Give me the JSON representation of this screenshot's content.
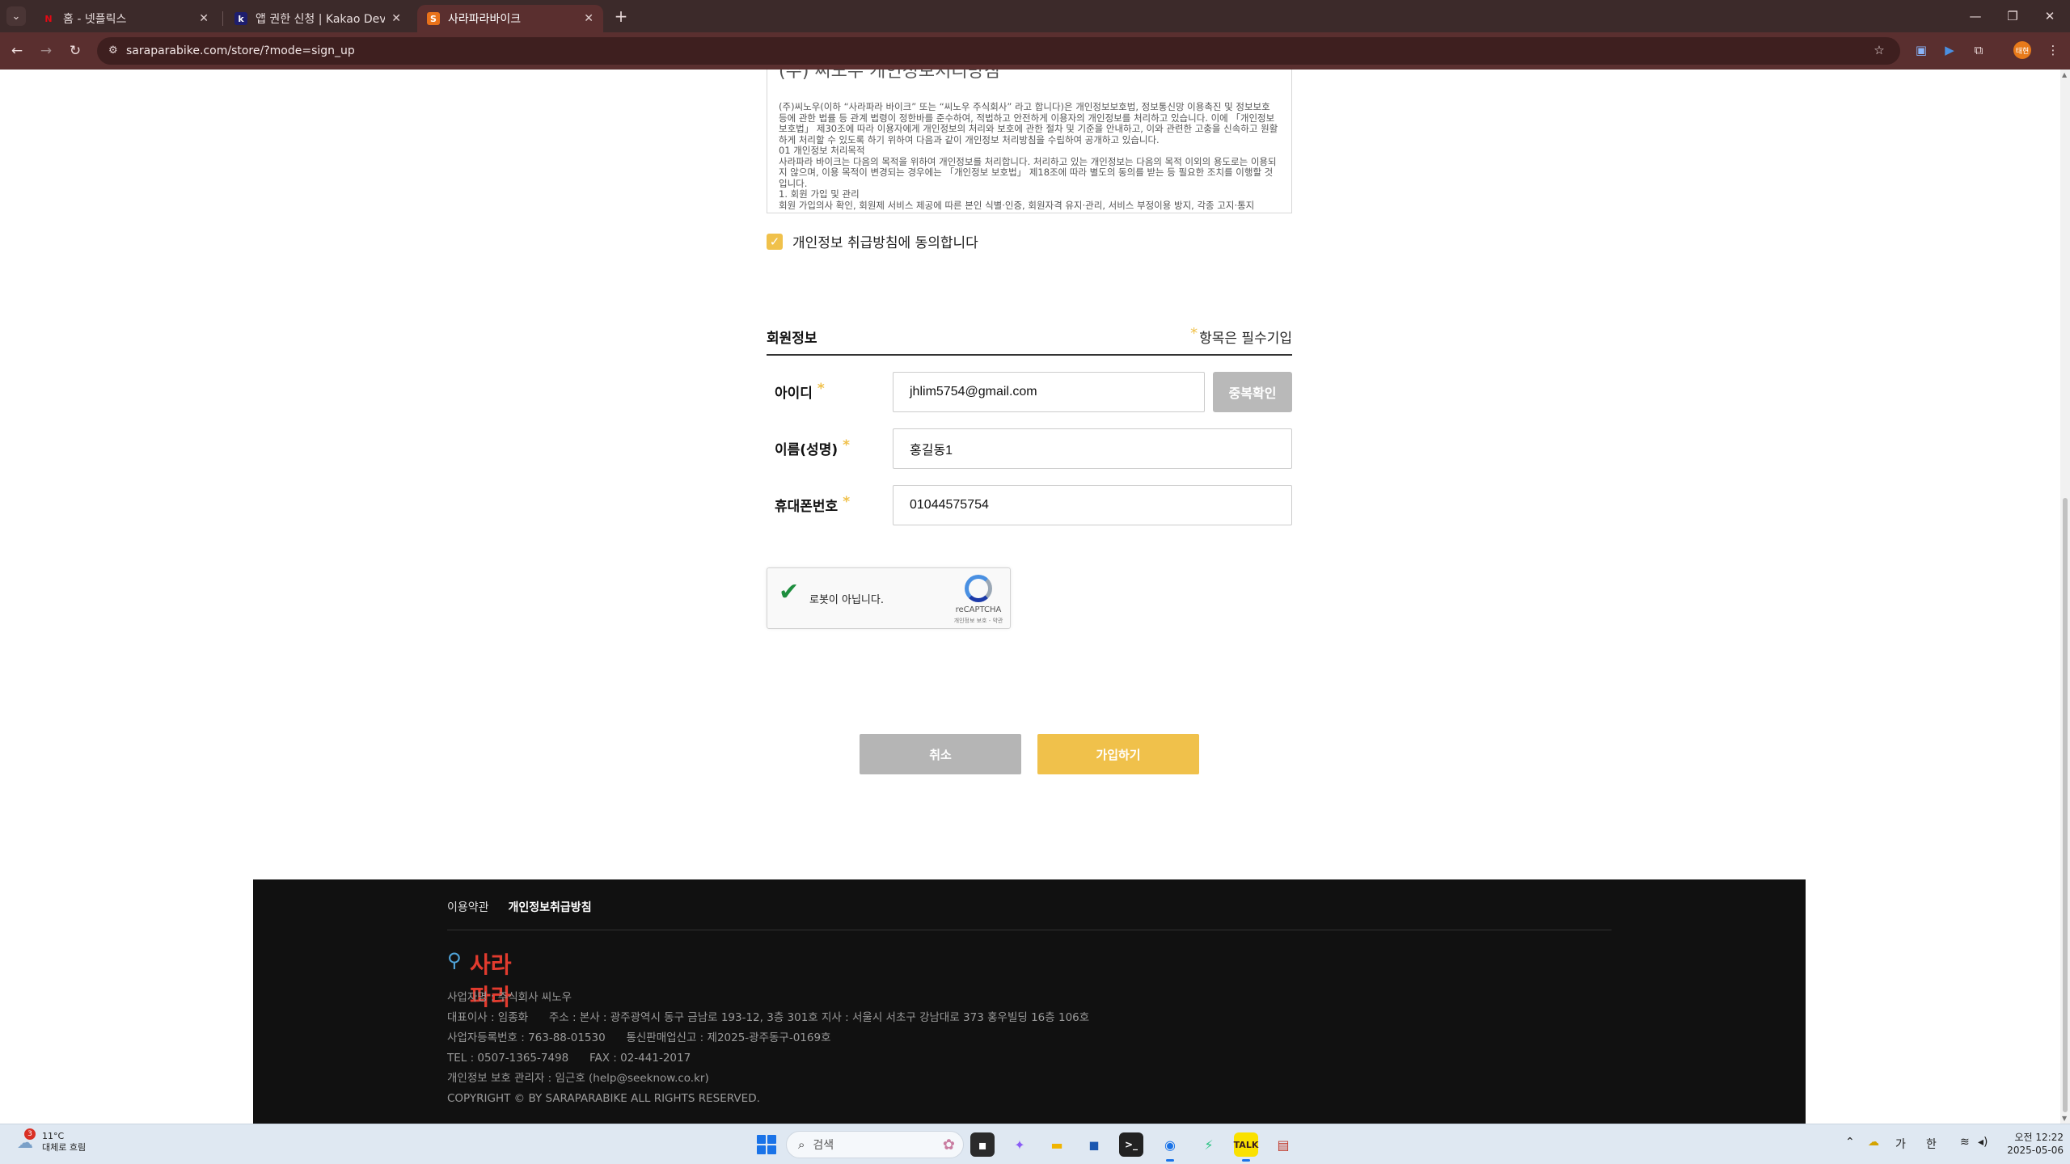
{
  "browser": {
    "tabs": [
      {
        "title": "홈 - 넷플릭스",
        "favicon": "N",
        "favicon_color": "#e50914"
      },
      {
        "title": "앱 권한 신청 | Kakao Developers",
        "favicon": "k",
        "favicon_color": "#1e1e6e"
      },
      {
        "title": "사라파라바이크",
        "favicon": "S",
        "favicon_color": "#e8711a"
      }
    ],
    "url": "saraparabike.com/store/?mode=sign_up",
    "profile_label": "태현"
  },
  "terms": {
    "heading": "(주) 씨노우 개인정보처리방침",
    "text": "(주)씨노우(이하 “사라파라 바이크” 또는 “씨노우 주식회사” 라고 합니다)은 개인정보보호법, 정보통신망 이용촉진 및 정보보호 등에 관한 법률 등 관계 법령이 정한바를 준수하여, 적법하고 안전하게 이용자의 개인정보를 처리하고 있습니다. 이에 「개인정보 보호법」 제30조에 따라 이용자에게 개인정보의 처리와 보호에 관한 절차 및 기준을 안내하고, 이와 관련한 고충을 신속하고 원활하게 처리할 수 있도록 하기 위하여 다음과 같이 개인정보 처리방침을 수립하여 공개하고 있습니다.\n01 개인정보 처리목적\n사라파라 바이크는 다음의 목적을 위하여 개인정보를 처리합니다. 처리하고 있는 개인정보는 다음의 목적 이외의 용도로는 이용되지 않으며, 이용 목적이 변경되는 경우에는 「개인정보 보호법」 제18조에 따라 별도의 동의를 받는 등 필요한 조치를 이행할 것입니다.\n1. 회원 가입 및 관리\n회원 가입의사 확인, 회원제 서비스 제공에 따른 본인 식별·인증, 회원자격 유지·관리, 서비스 부정이용 방지, 각종 고지·통지"
  },
  "agree": {
    "label": "개인정보 취급방침에 동의합니다",
    "checked": true
  },
  "member_section": {
    "title": "회원정보",
    "required_note": "항목은 필수기입",
    "star": "*"
  },
  "fields": {
    "id": {
      "label": "아이디",
      "value": "jhlim5754@gmail.com",
      "check_button": "중복확인"
    },
    "name": {
      "label": "이름(성명)",
      "value": "홍길동1"
    },
    "phone": {
      "label": "휴대폰번호",
      "value": "01044575754"
    }
  },
  "recaptcha": {
    "label": "로봇이 아닙니다.",
    "brand": "reCAPTCHA",
    "legal": "개인정보 보호 - 약관",
    "checked": true
  },
  "buttons": {
    "cancel": "취소",
    "join": "가입하기"
  },
  "footer": {
    "links": [
      "이용약관",
      "개인정보취급방침"
    ],
    "logo_text": "사라파라",
    "info": [
      "사업자명 : 주식회사 씨노우",
      "대표이사 : 임종화      주소 : 본사 : 광주광역시 동구 금남로 193-12, 3층 301호 지사 : 서울시 서초구 강남대로 373 홍우빌딩 16층 106호",
      "사업자등록번호 : 763-88-01530      통신판매업신고 : 제2025-광주동구-0169호",
      "TEL : 0507-1365-7498      FAX : 02-441-2017",
      "개인정보 보호 관리자 : 임근호 (help@seeknow.co.kr)",
      "COPYRIGHT © BY SARAPARABIKE ALL RIGHTS RESERVED."
    ]
  },
  "taskbar": {
    "weather_temp": "11°C",
    "weather_desc": "대체로 흐림",
    "weather_badge": "3",
    "search_placeholder": "검색",
    "ime_1": "가",
    "ime_2": "한",
    "time": "오전 12:22",
    "date": "2025-05-06"
  },
  "colors": {
    "accent": "#f0c14b",
    "chrome": "#5a2f2f",
    "footer_bg": "#111111"
  }
}
